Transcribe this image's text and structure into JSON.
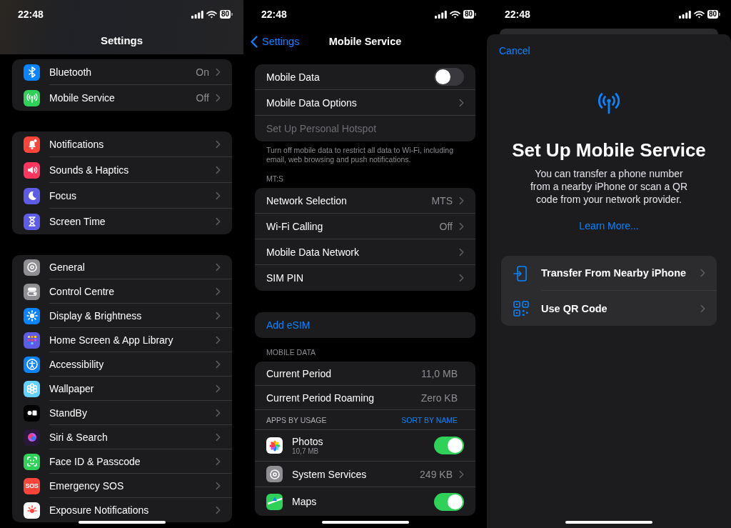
{
  "settings_screen": {
    "status_bar": {
      "time": "22:48",
      "battery": "80"
    },
    "title": "Settings",
    "groups": [
      {
        "rows": [
          {
            "label": "Bluetooth",
            "value": "On",
            "color": "#0a84ff"
          },
          {
            "label": "Mobile Service",
            "value": "Off",
            "color": "#30d158"
          }
        ]
      },
      {
        "rows": [
          {
            "label": "Notifications",
            "color": "#ff453a"
          },
          {
            "label": "Sounds & Haptics",
            "color": "#ff375f"
          },
          {
            "label": "Focus",
            "color": "#5e5ce6"
          },
          {
            "label": "Screen Time",
            "color": "#5e5ce6"
          }
        ]
      },
      {
        "rows": [
          {
            "label": "General",
            "color": "#8e8e93"
          },
          {
            "label": "Control Centre",
            "color": "#8e8e93"
          },
          {
            "label": "Display & Brightness",
            "color": "#0a84ff"
          },
          {
            "label": "Home Screen & App Library",
            "color": "#5e5ce6"
          },
          {
            "label": "Accessibility",
            "color": "#0a84ff"
          },
          {
            "label": "Wallpaper",
            "color": "#64d2ff"
          },
          {
            "label": "StandBy",
            "color": "#000000"
          },
          {
            "label": "Siri & Search",
            "color": "#2a1838"
          },
          {
            "label": "Face ID & Passcode",
            "color": "#30d158"
          },
          {
            "label": "Emergency SOS",
            "color": "#ff453a",
            "icon_text": "SOS"
          },
          {
            "label": "Exposure Notifications",
            "color": "#ffffff"
          }
        ]
      }
    ]
  },
  "mobile_service_screen": {
    "status_bar": {
      "time": "22:48",
      "battery": "80"
    },
    "back": "Settings",
    "title": "Mobile Service",
    "sections": [
      {
        "rows": [
          {
            "kind": "toggle",
            "label": "Mobile Data",
            "on": false
          },
          {
            "kind": "link",
            "label": "Mobile Data Options"
          },
          {
            "kind": "disabled",
            "label": "Set Up Personal Hotspot"
          }
        ],
        "footer": "Turn off mobile data to restrict all data to Wi-Fi, including email, web browsing and push notifications."
      },
      {
        "header": "MT:S",
        "rows": [
          {
            "kind": "link",
            "label": "Network Selection",
            "value": "MTS"
          },
          {
            "kind": "link",
            "label": "Wi-Fi Calling",
            "value": "Off"
          },
          {
            "kind": "link",
            "label": "Mobile Data Network"
          },
          {
            "kind": "link",
            "label": "SIM PIN"
          }
        ]
      },
      {
        "rows": [
          {
            "kind": "action",
            "label": "Add eSIM"
          }
        ]
      },
      {
        "header": "MOBILE DATA",
        "rows": [
          {
            "kind": "stat",
            "label": "Current Period",
            "value": "11,0 MB"
          },
          {
            "kind": "stat",
            "label": "Current Period Roaming",
            "value": "Zero KB"
          },
          {
            "kind": "subheader",
            "label": "APPS BY USAGE",
            "action": "SORT BY NAME"
          },
          {
            "kind": "app_toggle",
            "label": "Photos",
            "detail": "10,7 MB",
            "on": true
          },
          {
            "kind": "app_link",
            "label": "System Services",
            "value": "249 KB"
          },
          {
            "kind": "app_toggle",
            "label": "Maps",
            "on": true
          }
        ]
      }
    ]
  },
  "setup_sheet": {
    "status_bar": {
      "time": "22:48",
      "battery": "80"
    },
    "cancel": "Cancel",
    "title": "Set Up Mobile Service",
    "body": "You can transfer a phone number from a nearby iPhone or scan a QR code from your network provider.",
    "link": "Learn More...",
    "options": [
      {
        "label": "Transfer From Nearby iPhone"
      },
      {
        "label": "Use QR Code"
      }
    ]
  }
}
